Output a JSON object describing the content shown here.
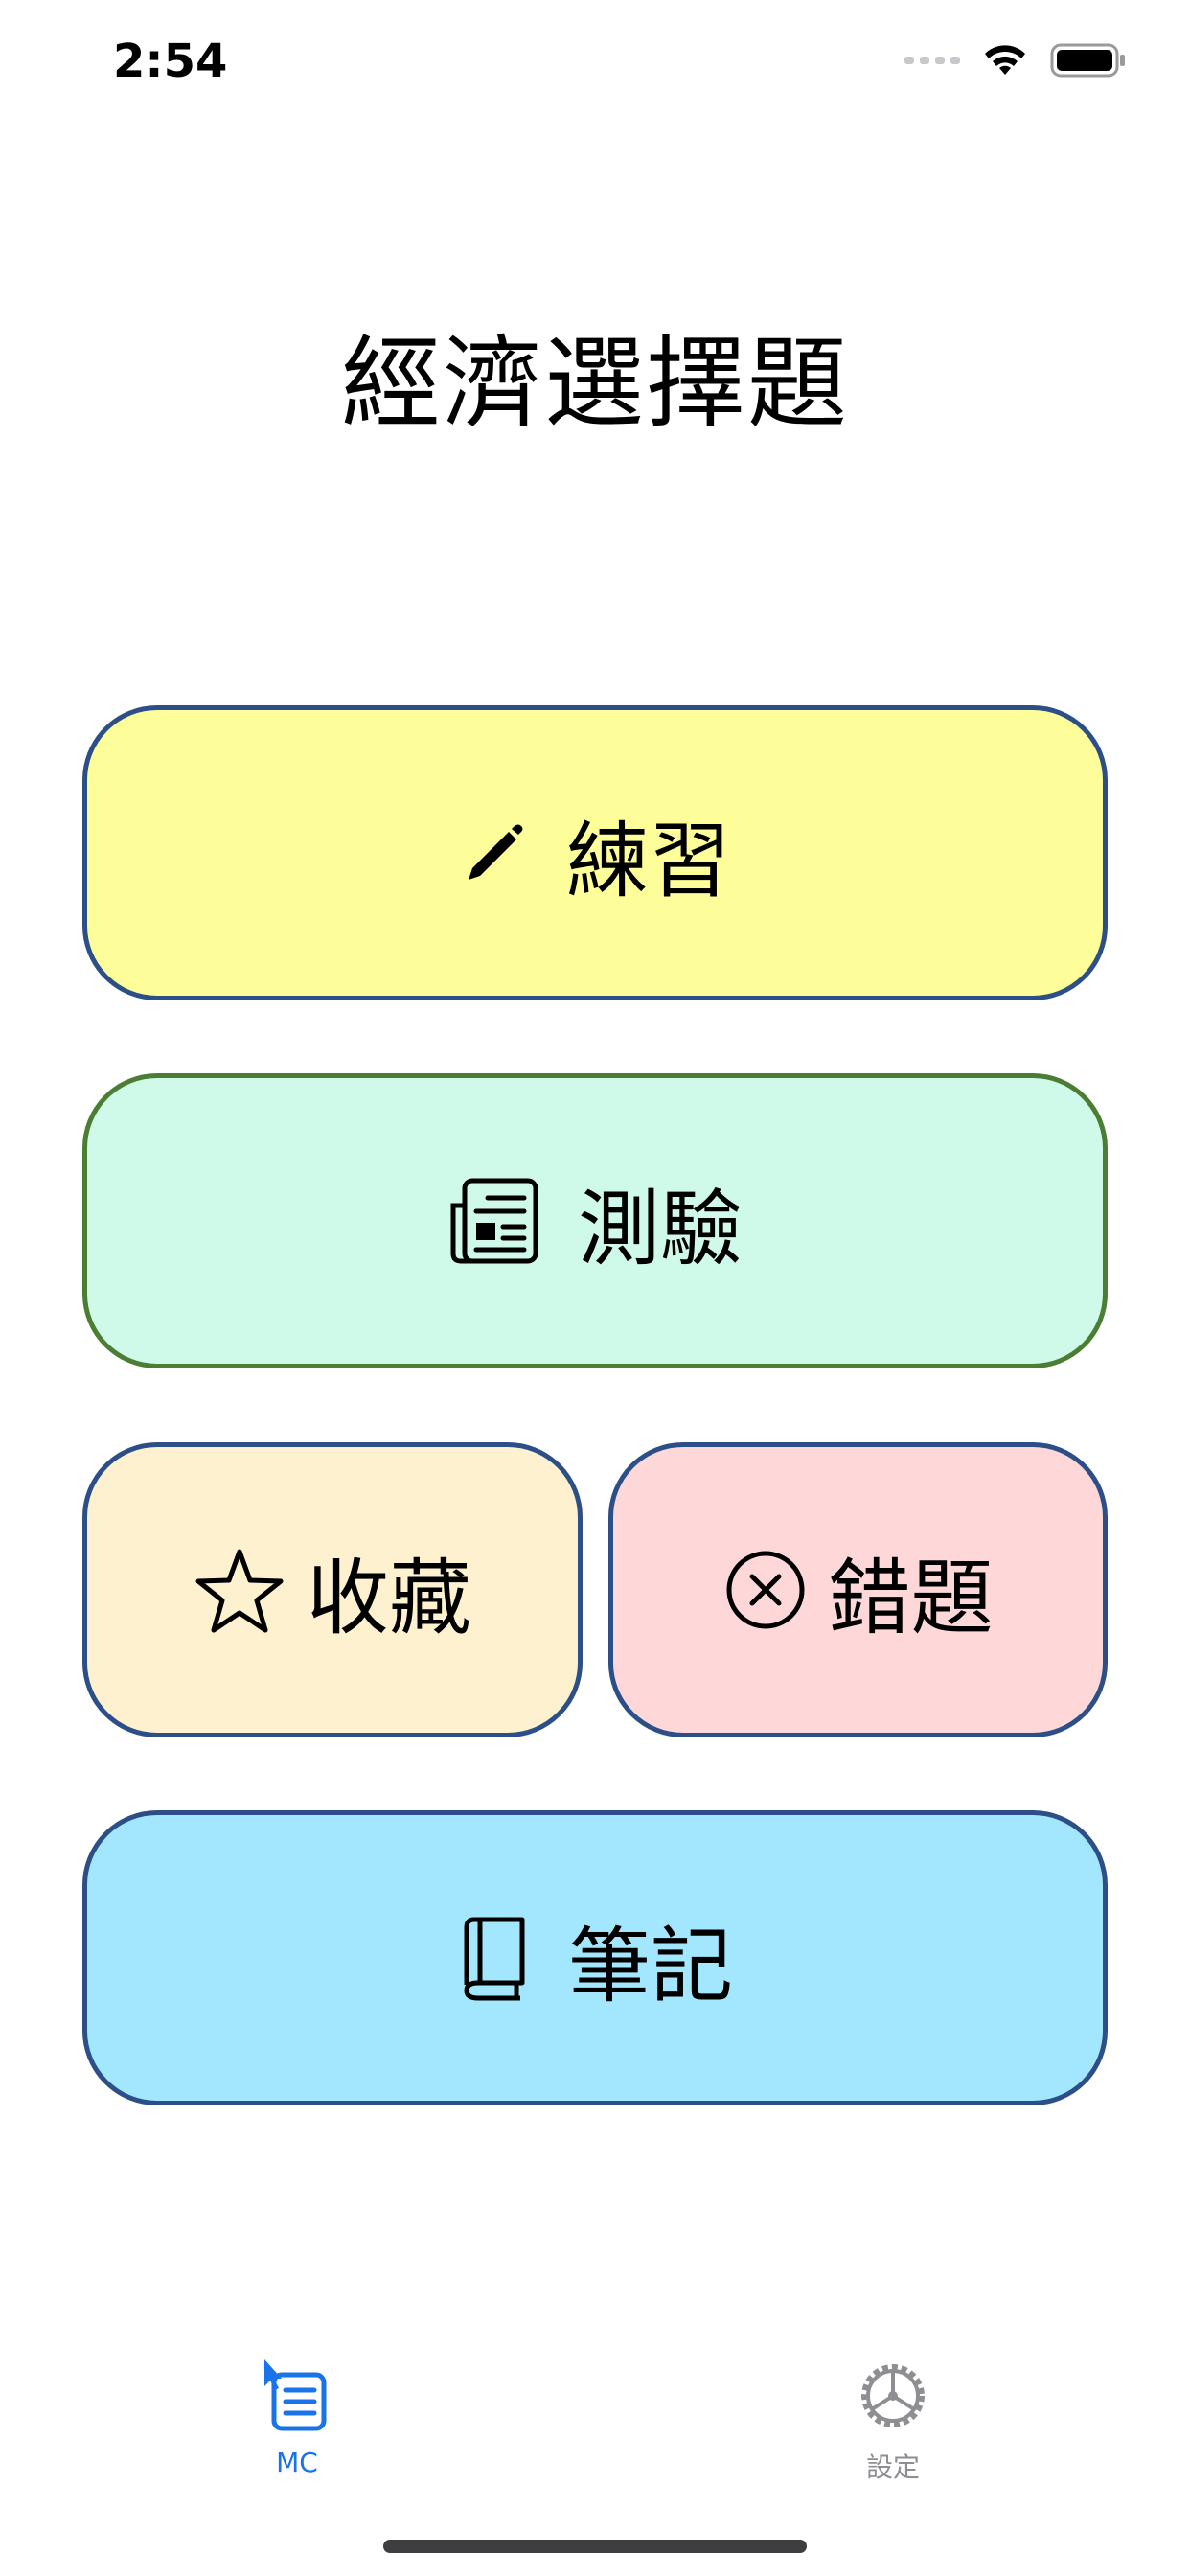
{
  "status_bar": {
    "time": "2:54",
    "icons": [
      "signal-dots-icon",
      "wifi-icon",
      "battery-icon"
    ]
  },
  "title": "經濟選擇題",
  "buttons": {
    "practice": {
      "label": "練習",
      "icon": "pencil-icon",
      "color": "#fdfd99"
    },
    "quiz": {
      "label": "測驗",
      "icon": "newspaper-icon",
      "color": "#cff9e9"
    },
    "favorites": {
      "label": "收藏",
      "icon": "star-icon",
      "color": "#fdf1cf"
    },
    "wrong": {
      "label": "錯題",
      "icon": "x-circle-icon",
      "color": "#fed8d9"
    },
    "notes": {
      "label": "筆記",
      "icon": "book-icon",
      "color": "#a3e7fe"
    }
  },
  "tabbar": {
    "tabs": [
      {
        "label": "MC",
        "icon": "list-icon",
        "active": true,
        "color": "#1a73e8"
      },
      {
        "label": "設定",
        "icon": "gear-icon",
        "active": false,
        "color": "#8e8e93"
      }
    ]
  }
}
